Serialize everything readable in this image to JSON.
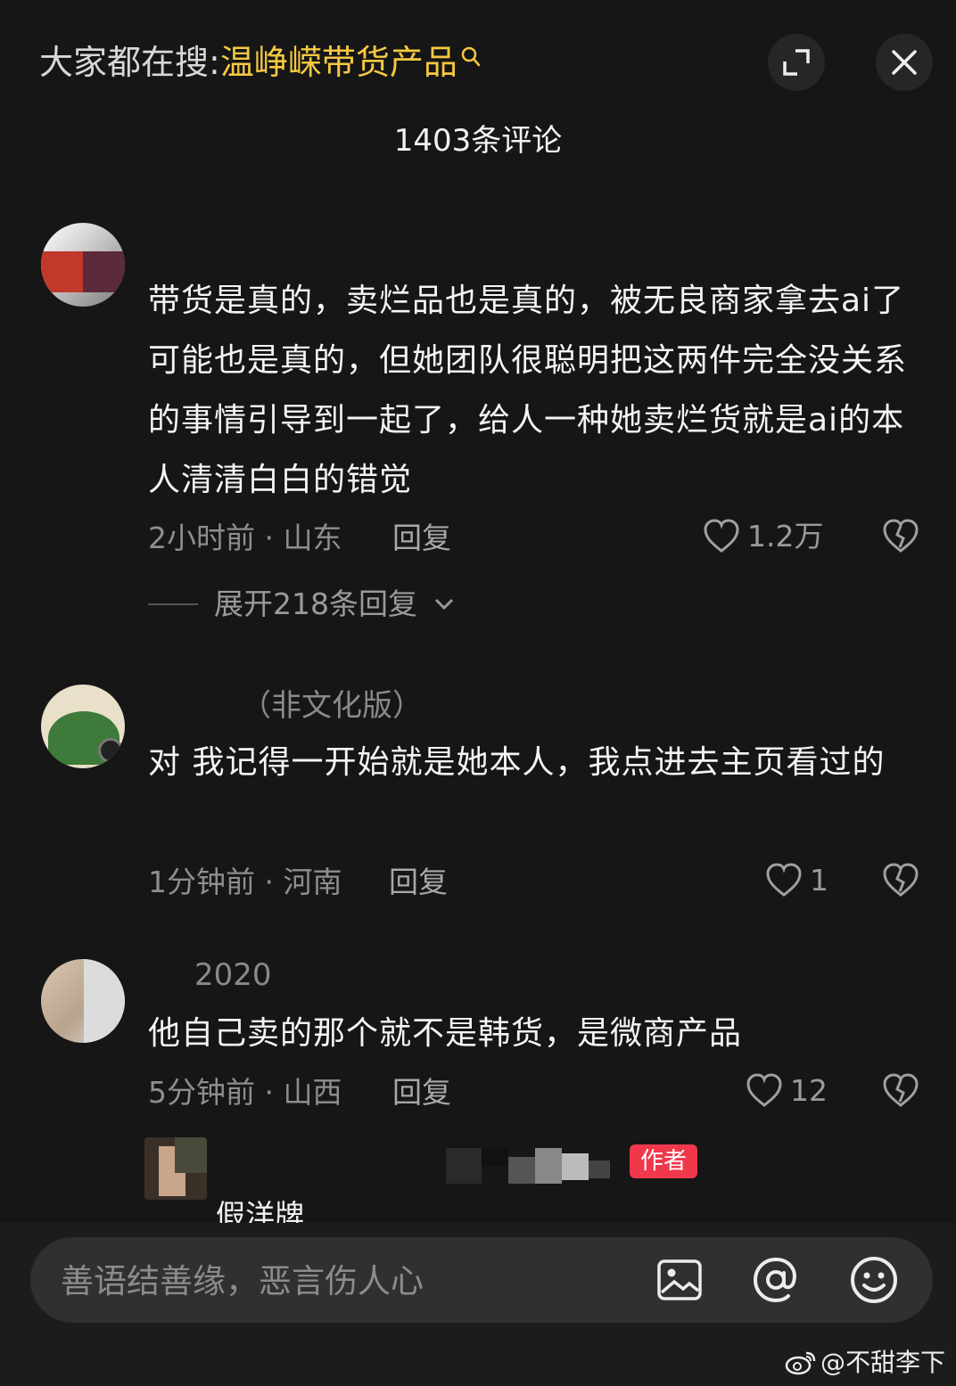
{
  "header": {
    "search_prefix": "大家都在搜:",
    "search_keyword": "温峥嵘带货产品",
    "comment_count": "1403条评论"
  },
  "comments": [
    {
      "username": "",
      "text": "带货是真的，卖烂品也是真的，被无良商家拿去ai了可能也是真的，但她团队很聪明把这两件完全没关系的事情引导到一起了，给人一种她卖烂货就是ai的本人清清白白的错觉",
      "time_location": "2小时前 · 山东",
      "reply_label": "回复",
      "likes": "1.2万",
      "expand_replies": "展开218条回复"
    },
    {
      "username": "（非文化版）",
      "text": "对 我记得一开始就是她本人，我点进去主页看过的",
      "time_location": "1分钟前 · 河南",
      "reply_label": "回复",
      "likes": "1"
    },
    {
      "username": "2020",
      "text": "他自己卖的那个就不是韩货，是微商产品",
      "time_location": "5分钟前 · 山西",
      "reply_label": "回复",
      "likes": "12"
    }
  ],
  "sub_reply": {
    "author_badge": "作者",
    "text": "假洋牌"
  },
  "input": {
    "placeholder": "善语结善缘，恶言伤人心"
  },
  "watermark": "@不甜李下",
  "colors": {
    "background": "#161616",
    "keyword": "#f5c842",
    "author_badge": "#f0384d"
  }
}
